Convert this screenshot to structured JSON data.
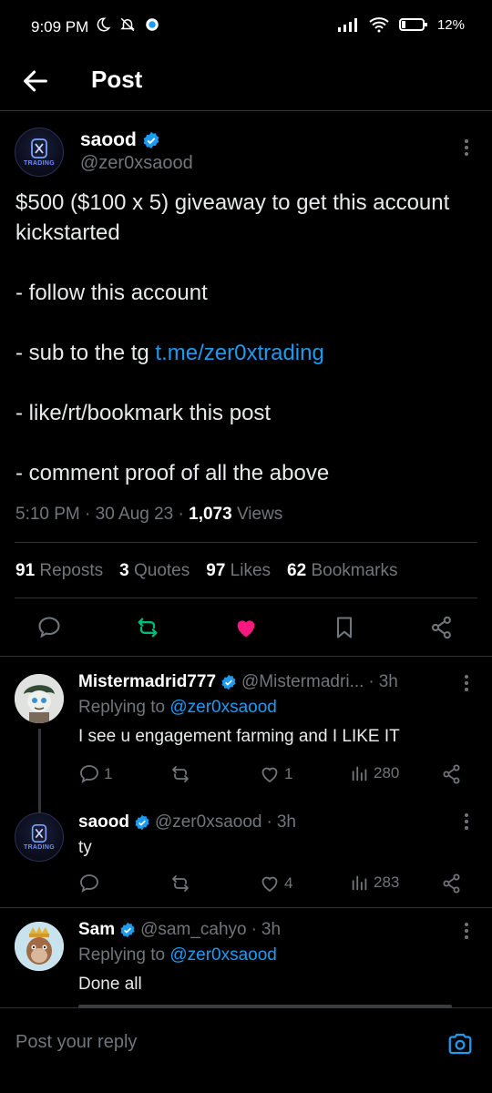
{
  "status_bar": {
    "time": "9:09 PM",
    "battery": "12%"
  },
  "header": {
    "title": "Post"
  },
  "post": {
    "author_name": "saood",
    "author_handle": "@zer0xsaood",
    "avatar_tag": "TRADING",
    "line1": "$500 ($100 x 5) giveaway to get this account kickstarted",
    "line2": "- follow this account",
    "line3_prefix": "- sub to the tg ",
    "line3_link": "t.me/zer0xtrading",
    "line4": "- like/rt/bookmark this post",
    "line5": "- comment proof of all the above",
    "time": "5:10 PM",
    "date": "30 Aug 23",
    "views_count": "1,073",
    "views_label": "Views",
    "reposts_count": "91",
    "reposts_label": "Reposts",
    "quotes_count": "3",
    "quotes_label": "Quotes",
    "likes_count": "97",
    "likes_label": "Likes",
    "bookmarks_count": "62",
    "bookmarks_label": "Bookmarks",
    "liked": true,
    "colors": {
      "like": "#f91880",
      "repost": "#00ba7c",
      "link": "#1d9bf0",
      "verified": "#1d9bf0"
    }
  },
  "replies": [
    {
      "name": "Mistermadrid777",
      "handle": "@Mistermadri...",
      "age": "3h",
      "replying_label": "Replying to",
      "replying_to": "@zer0xsaood",
      "text": "I see u engagement farming and I LIKE IT",
      "replies": "1",
      "reposts": "",
      "likes": "1",
      "views": "280"
    },
    {
      "name": "saood",
      "handle": "@zer0xsaood",
      "age": "3h",
      "avatar_tag": "TRADING",
      "text": "ty",
      "replies": "",
      "reposts": "",
      "likes": "4",
      "views": "283"
    },
    {
      "name": "Sam",
      "handle": "@sam_cahyo",
      "age": "3h",
      "replying_label": "Replying to",
      "replying_to": "@zer0xsaood",
      "text": "Done all"
    }
  ],
  "compose": {
    "placeholder": "Post your reply"
  }
}
